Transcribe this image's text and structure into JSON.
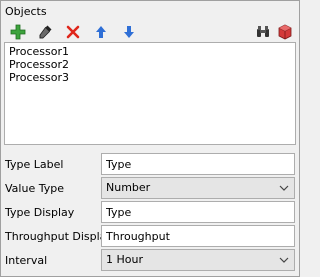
{
  "objects": {
    "title": "Objects",
    "toolbar": {
      "add": "add-icon",
      "sampler": "eyedropper-icon",
      "remove": "delete-icon",
      "move_up": "arrow-up-icon",
      "move_down": "arrow-down-icon",
      "find": "binoculars-icon",
      "select_3d": "cube-icon"
    },
    "items": [
      {
        "label": "Processor1"
      },
      {
        "label": "Processor2"
      },
      {
        "label": "Processor3"
      }
    ]
  },
  "form": {
    "type_label": {
      "label": "Type Label",
      "value": "Type"
    },
    "value_type": {
      "label": "Value Type",
      "value": "Number"
    },
    "type_display": {
      "label": "Type Display",
      "value": "Type"
    },
    "throughput_display": {
      "label": "Throughput Display",
      "value": "Throughput"
    },
    "interval": {
      "label": "Interval",
      "value": "1 Hour"
    }
  },
  "colors": {
    "add_green": "#3da33d",
    "delete_red": "#e0261b",
    "arrow_blue": "#2f6fd6",
    "cube_red": "#d43a3a"
  }
}
